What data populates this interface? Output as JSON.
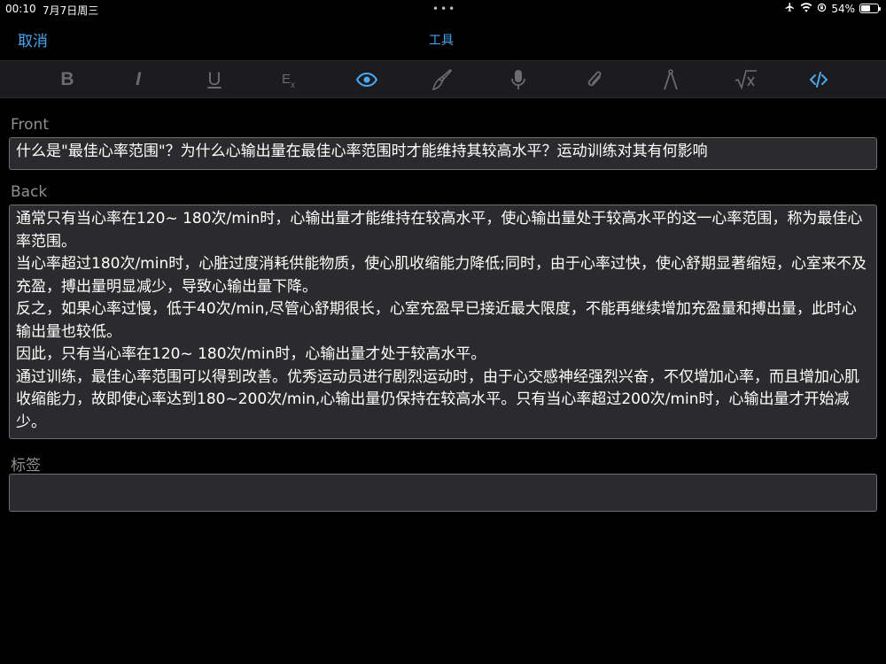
{
  "status_bar": {
    "time": "00:10",
    "date": "7月7日周三",
    "dots": "•••",
    "battery_percent": "54%",
    "battery_level": 0.54
  },
  "nav": {
    "cancel_label": "取消",
    "title": "工具"
  },
  "toolbar": {
    "items": [
      {
        "name": "bold-icon",
        "glyph": "B"
      },
      {
        "name": "italic-icon",
        "glyph": "I"
      },
      {
        "name": "underline-icon",
        "glyph": "U"
      },
      {
        "name": "clear-format-icon",
        "glyph": "Ex"
      },
      {
        "name": "eye-icon",
        "active": true
      },
      {
        "name": "paintbrush-icon"
      },
      {
        "name": "microphone-icon"
      },
      {
        "name": "paperclip-icon"
      },
      {
        "name": "compass-icon"
      },
      {
        "name": "math-sqrt-icon"
      },
      {
        "name": "code-icon",
        "active": true
      }
    ]
  },
  "fields": {
    "front_label": "Front",
    "front_value": "什么是\"最佳心率范围\"？为什么心输出量在最佳心率范围时才能维持其较高水平？运动训练对其有何影响",
    "back_label": "Back",
    "back_paragraphs": [
      "通常只有当心率在120~ 180次/min时，心输出量才能维持在较高水平，使心输出量处于较高水平的这一心率范围，称为最佳心率范围。",
      "当心率超过180次/min时，心脏过度消耗供能物质，使心肌收缩能力降低;同时，由于心率过快，使心舒期显著缩短，心室来不及充盈，搏出量明显减少，导致心输出量下降。",
      "反之，如果心率过慢，低于40次/min,尽管心舒期很长，心室充盈早已接近最大限度，不能再继续增加充盈量和搏出量，此时心输出量也较低。",
      "因此，只有当心率在120~ 180次/min时，心输出量才处于较高水平。",
      "通过训练，最佳心率范围可以得到改善。优秀运动员进行剧烈运动时，由于心交感神经强烈兴奋，不仅增加心率，而且增加心肌收缩能力，故即使心率达到180~200次/min,心输出量仍保持在较高水平。只有当心率超过200次/min时，心输出量才开始减少。"
    ],
    "tags_label": "标签",
    "tags_value": ""
  }
}
